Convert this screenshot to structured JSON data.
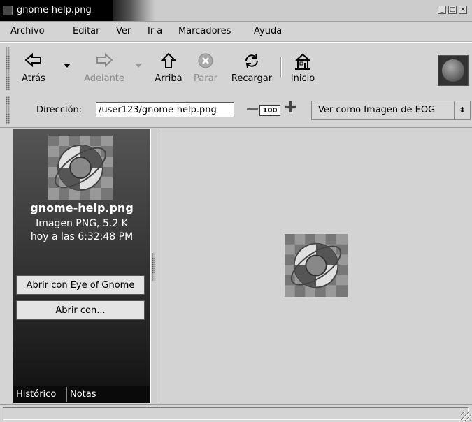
{
  "window": {
    "title": "gnome-help.png",
    "wm_buttons": [
      "_",
      "□",
      "×"
    ]
  },
  "menubar": {
    "items": [
      "Archivo",
      "Editar",
      "Ver",
      "Ir a",
      "Marcadores",
      "Ayuda"
    ]
  },
  "toolbar": {
    "back": "Atrás",
    "forward": "Adelante",
    "up": "Arriba",
    "stop": "Parar",
    "reload": "Recargar",
    "home": "Inicio"
  },
  "location": {
    "label": "Dirección:",
    "value": "/user123/gnome-help.png",
    "zoom": "100",
    "view_as": "Ver como Imagen de EOG"
  },
  "sidebar": {
    "file_name": "gnome-help.png",
    "file_type": "Imagen PNG, 5.2 K",
    "modified": "hoy a las 6:32:48 PM",
    "open_with_default": "Abrir con Eye of Gnome",
    "open_with": "Abrir con...",
    "tabs": [
      "Histórico",
      "Notas"
    ]
  },
  "colors": {
    "sidebar_top": "#555555",
    "sidebar_bottom": "#101010",
    "content_bg": "#d3d3d3"
  },
  "icons": [
    "back-arrow-icon",
    "forward-arrow-icon",
    "up-arrow-icon",
    "stop-icon",
    "reload-icon",
    "home-icon",
    "throbber-icon",
    "lifebuoy-icon",
    "zoom-minus-icon",
    "zoom-plus-icon"
  ]
}
